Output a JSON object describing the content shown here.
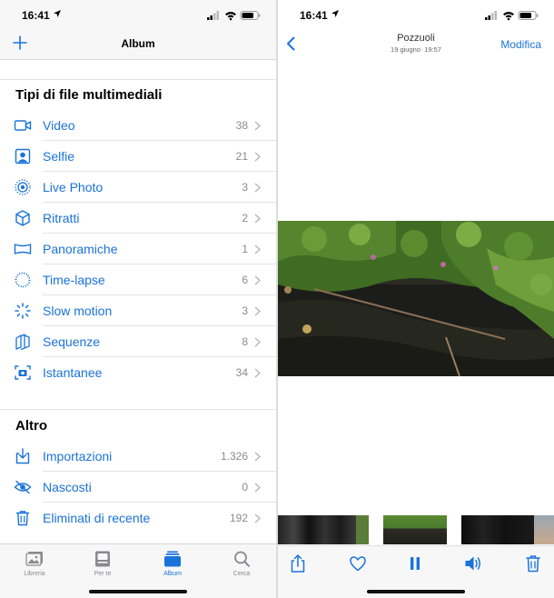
{
  "left_screen": {
    "status": {
      "time": "16:41"
    },
    "nav": {
      "title": "Album",
      "add_icon": "plus-icon"
    },
    "sections": [
      {
        "title": "Tipi di file multimediali",
        "items": [
          {
            "label": "Video",
            "count": "38",
            "icon": "video-icon"
          },
          {
            "label": "Selfie",
            "count": "21",
            "icon": "selfie-icon"
          },
          {
            "label": "Live Photo",
            "count": "3",
            "icon": "live-photo-icon"
          },
          {
            "label": "Ritratti",
            "count": "2",
            "icon": "portrait-cube-icon"
          },
          {
            "label": "Panoramiche",
            "count": "1",
            "icon": "panorama-icon"
          },
          {
            "label": "Time-lapse",
            "count": "6",
            "icon": "timelapse-icon"
          },
          {
            "label": "Slow motion",
            "count": "3",
            "icon": "slow-motion-icon"
          },
          {
            "label": "Sequenze",
            "count": "8",
            "icon": "burst-icon"
          },
          {
            "label": "Istantanee",
            "count": "34",
            "icon": "screenshot-icon"
          }
        ]
      },
      {
        "title": "Altro",
        "items": [
          {
            "label": "Importazioni",
            "count": "1.326",
            "icon": "import-icon"
          },
          {
            "label": "Nascosti",
            "count": "0",
            "icon": "hidden-eye-icon"
          },
          {
            "label": "Eliminati di recente",
            "count": "192",
            "icon": "trash-icon"
          }
        ]
      }
    ],
    "tabbar": {
      "tabs": [
        {
          "label": "Libreria",
          "icon": "library-photos-icon",
          "active": false
        },
        {
          "label": "Per te",
          "icon": "for-you-icon",
          "active": false
        },
        {
          "label": "Album",
          "icon": "albums-icon",
          "active": true
        },
        {
          "label": "Cerca",
          "icon": "search-icon",
          "active": false
        }
      ]
    }
  },
  "right_screen": {
    "status": {
      "time": "16:41"
    },
    "nav": {
      "back_icon": "chevron-left-icon",
      "title": "Pozzuoli",
      "date": "19 giugno",
      "time": "19:57",
      "edit_label": "Modifica"
    },
    "toolbar": {
      "icons": [
        "share-icon",
        "heart-icon",
        "pause-icon",
        "speaker-icon",
        "trash-icon"
      ]
    }
  },
  "colors": {
    "accent": "#1a73d9",
    "secondary_text": "#8a8a8e",
    "bar_background": "#f7f7f8"
  }
}
